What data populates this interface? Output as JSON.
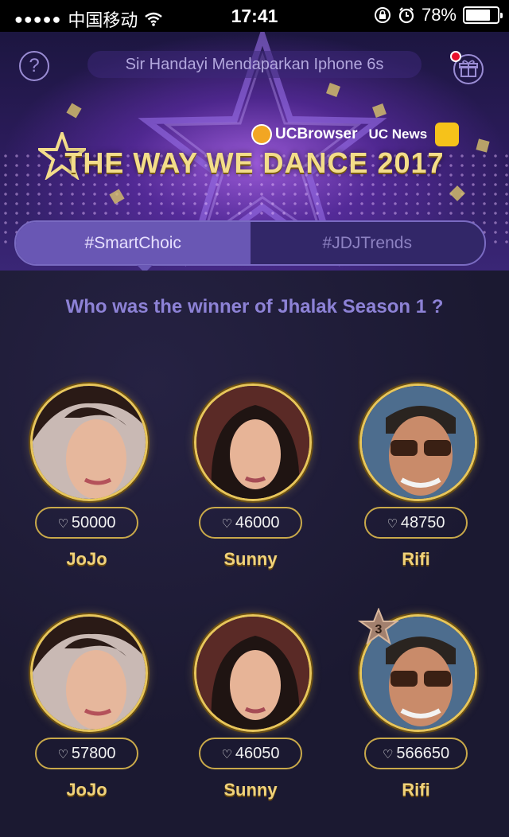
{
  "status_bar": {
    "signal_dots": "●●●●●",
    "carrier": "中国移动",
    "wifi_icon": "wifi-icon",
    "time": "17:41",
    "battery_percent": "78%",
    "battery_level": 0.78
  },
  "banner": {
    "help_label": "?",
    "ticker_text": "Sir Handayi Mendaparkan Iphone 6s",
    "brand_uc": "UCBrowser",
    "brand_news": "UC News",
    "title": "THE WAY WE DANCE 2017"
  },
  "tabs": [
    {
      "label": "#SmartChoic",
      "active": true
    },
    {
      "label": "#JDJTrends",
      "active": false
    }
  ],
  "question": "Who was the winner of Jhalak Season 1 ?",
  "contestants": [
    {
      "name": "JoJo",
      "votes": "50000"
    },
    {
      "name": "Sunny",
      "votes": "46000"
    },
    {
      "name": "Rifi",
      "votes": "48750"
    },
    {
      "name": "JoJo",
      "votes": "57800"
    },
    {
      "name": "Sunny",
      "votes": "46050"
    },
    {
      "name": "Rifi",
      "votes": "566650",
      "rank": "3"
    }
  ],
  "colors": {
    "accent": "#6957b4",
    "gold": "#e8c65a",
    "question": "#8d82d6",
    "background": "#1b1931"
  }
}
